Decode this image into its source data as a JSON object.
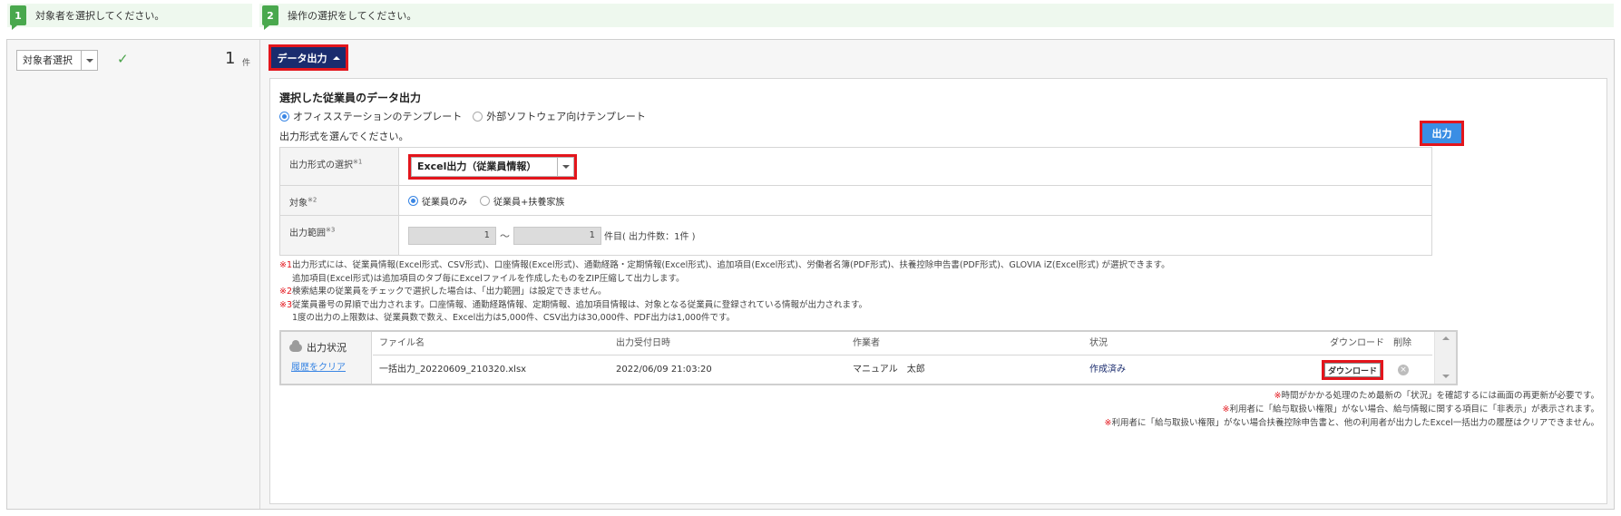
{
  "steps": [
    {
      "num": "1",
      "label": "対象者を選択してください。"
    },
    {
      "num": "2",
      "label": "操作の選択をしてください。"
    }
  ],
  "left": {
    "select_label": "対象者選択",
    "check": "✓",
    "count": "1",
    "count_unit": "件"
  },
  "toolbar": {
    "data_export_label": "データ出力"
  },
  "panel": {
    "title": "選択した従業員のデータ出力",
    "template_options": [
      {
        "label": "オフィスステーションのテンプレート",
        "selected": true
      },
      {
        "label": "外部ソフトウェア向けテンプレート",
        "selected": false
      }
    ],
    "hint": "出力形式を選んでください。",
    "output_button": "出力"
  },
  "form": {
    "format_label": "出力形式の選択",
    "format_mark": "※1",
    "format_value": "Excel出力（従業員情報）",
    "target_label": "対象",
    "target_mark": "※2",
    "target_options": [
      {
        "label": "従業員のみ",
        "selected": true
      },
      {
        "label": "従業員+扶養家族",
        "selected": false
      }
    ],
    "range_label": "出力範囲",
    "range_mark": "※3",
    "range_from": "1",
    "range_sep": "〜",
    "range_to": "1",
    "range_tail": "件目( 出力件数：1件 )"
  },
  "notes": {
    "n1_mark": "※1",
    "n1_line1": "出力形式には、従業員情報(Excel形式、CSV形式)、口座情報(Excel形式)、通勤経路・定期情報(Excel形式)、追加項目(Excel形式)、労働者名簿(PDF形式)、扶養控除申告書(PDF形式)、GLOVIA iZ(Excel形式) が選択できます。",
    "n1_line2": "追加項目(Excel形式)は追加項目のタブ毎にExcelファイルを作成したものをZIP圧縮して出力します。",
    "n2_mark": "※2",
    "n2_line1": "検索結果の従業員をチェックで選択した場合は、「出力範囲」は設定できません。",
    "n3_mark": "※3",
    "n3_line1": "従業員番号の昇順で出力されます。口座情報、通勤経路情報、定期情報、追加項目情報は、対象となる従業員に登録されている情報が出力されます。",
    "n3_line2": "1度の出力の上限数は、従業員数で数え、Excel出力は5,000件、CSV出力は30,000件、PDF出力は1,000件です。"
  },
  "status": {
    "title": "出力状況",
    "clear_link": "履歴をクリア",
    "columns": [
      "ファイル名",
      "出力受付日時",
      "作業者",
      "状況",
      "ダウンロード",
      "削除"
    ],
    "rows": [
      {
        "file": "一括出力_20220609_210320.xlsx",
        "datetime": "2022/06/09 21:03:20",
        "worker": "マニュアル　太郎",
        "state": "作成済み",
        "download": "ダウンロード"
      }
    ]
  },
  "bottom_notes": [
    {
      "mark": "※",
      "text": "時間がかかる処理のため最新の「状況」を確認するには画面の再更新が必要です。"
    },
    {
      "mark": "※",
      "text": "利用者に「給与取扱い権限」がない場合、給与情報に関する項目に「非表示」が表示されます。"
    },
    {
      "mark": "※",
      "text": "利用者に「給与取扱い権限」がない場合扶養控除申告書と、他の利用者が出力したExcel一括出力の履歴はクリアできません。"
    }
  ],
  "colors": {
    "step_green": "#49a84d",
    "highlight_red": "#e3151c",
    "data_button_navy": "#1a2c6e",
    "output_button_blue": "#3a8ee4",
    "link_blue": "#3a86e4"
  }
}
